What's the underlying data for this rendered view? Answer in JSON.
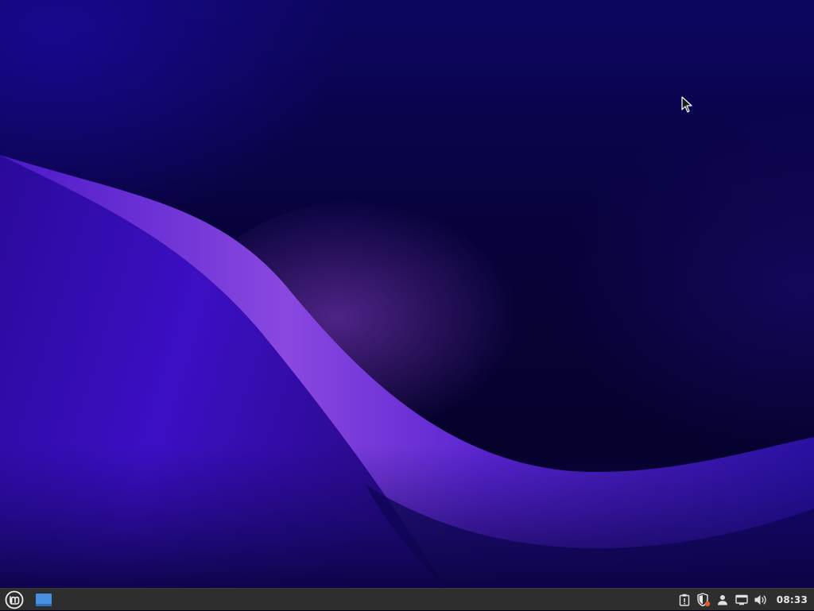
{
  "desktop": {
    "wallpaper": "purple-wave-wallpaper",
    "colors": {
      "wave_highlight": "#9b59e6",
      "wave_body": "#3d10c8",
      "deep_background": "#040122"
    }
  },
  "taskbar": {
    "background_color": "#2e2e2e",
    "menu_icon": "mint-logo-icon",
    "show_desktop_icon": "show-desktop-icon",
    "tray": {
      "icons": [
        "clipboard-icon",
        "update-shield-icon",
        "user-icon",
        "network-icon",
        "volume-icon"
      ],
      "clock": "08:33"
    }
  }
}
